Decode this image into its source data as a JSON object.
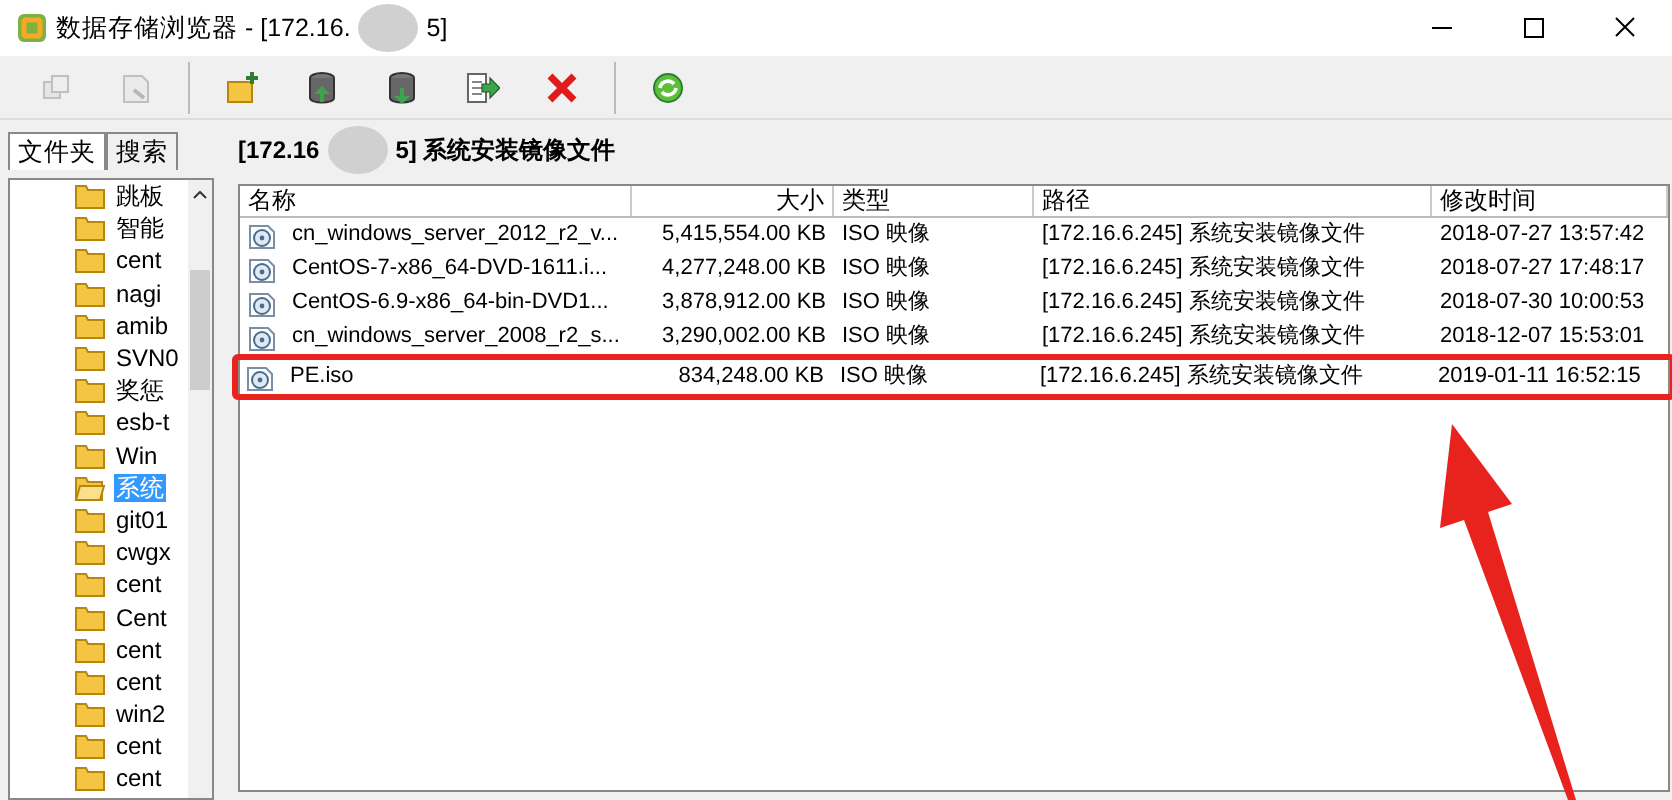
{
  "window": {
    "title_start": "数据存储浏览器 - [172.16.",
    "title_end": "5]"
  },
  "toolbar": [
    {
      "kind": "copy",
      "disabled": true
    },
    {
      "kind": "move",
      "disabled": true
    },
    {
      "kind": "sep"
    },
    {
      "kind": "newfolder",
      "disabled": false
    },
    {
      "kind": "upload",
      "disabled": false
    },
    {
      "kind": "download",
      "disabled": false
    },
    {
      "kind": "export",
      "disabled": false
    },
    {
      "kind": "delete",
      "disabled": false
    },
    {
      "kind": "sep"
    },
    {
      "kind": "refresh",
      "disabled": false
    }
  ],
  "tabs": [
    {
      "label": "文件夹",
      "selected": true
    },
    {
      "label": "搜索",
      "selected": false
    }
  ],
  "path_start": "[172.16",
  "path_end": "5] 系统安装镜像文件",
  "tree": [
    {
      "label": "跳板",
      "selected": false
    },
    {
      "label": "智能",
      "selected": false
    },
    {
      "label": "cent",
      "selected": false
    },
    {
      "label": "nagi",
      "selected": false
    },
    {
      "label": "amib",
      "selected": false
    },
    {
      "label": "SVN0",
      "selected": false
    },
    {
      "label": "奖惩",
      "selected": false
    },
    {
      "label": "esb-t",
      "selected": false
    },
    {
      "label": "Win",
      "selected": false
    },
    {
      "label": "系统",
      "selected": true
    },
    {
      "label": "git01",
      "selected": false
    },
    {
      "label": "cwgx",
      "selected": false
    },
    {
      "label": "cent",
      "selected": false
    },
    {
      "label": "Cent",
      "selected": false
    },
    {
      "label": "cent",
      "selected": false
    },
    {
      "label": "cent",
      "selected": false
    },
    {
      "label": "win2",
      "selected": false
    },
    {
      "label": "cent",
      "selected": false
    },
    {
      "label": "cent",
      "selected": false
    }
  ],
  "table": {
    "columns": [
      "名称",
      "大小",
      "类型",
      "路径",
      "修改时间"
    ],
    "rows": [
      {
        "name": "cn_windows_server_2012_r2_v...",
        "size": "5,415,554.00 KB",
        "type": "ISO 映像",
        "path": "[172.16.6.245] 系统安装镜像文件",
        "modified": "2018-07-27 13:57:42",
        "highlighted": false
      },
      {
        "name": "CentOS-7-x86_64-DVD-1611.i...",
        "size": "4,277,248.00 KB",
        "type": "ISO 映像",
        "path": "[172.16.6.245] 系统安装镜像文件",
        "modified": "2018-07-27 17:48:17",
        "highlighted": false
      },
      {
        "name": "CentOS-6.9-x86_64-bin-DVD1...",
        "size": "3,878,912.00 KB",
        "type": "ISO 映像",
        "path": "[172.16.6.245] 系统安装镜像文件",
        "modified": "2018-07-30 10:00:53",
        "highlighted": false
      },
      {
        "name": "cn_windows_server_2008_r2_s...",
        "size": "3,290,002.00 KB",
        "type": "ISO 映像",
        "path": "[172.16.6.245] 系统安装镜像文件",
        "modified": "2018-12-07 15:53:01",
        "highlighted": false
      },
      {
        "name": "PE.iso",
        "size": "834,248.00 KB",
        "type": "ISO 映像",
        "path": "[172.16.6.245] 系统安装镜像文件",
        "modified": "2019-01-11 16:52:15",
        "highlighted": true
      }
    ]
  }
}
